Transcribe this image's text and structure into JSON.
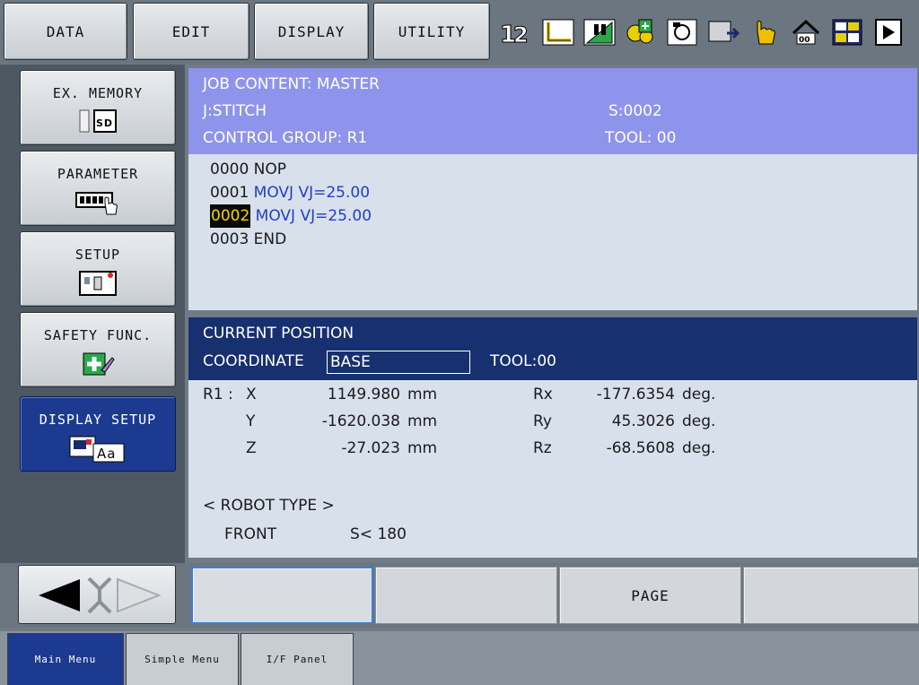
{
  "top_menu": {
    "data": "DATA",
    "edit": "EDIT",
    "display": "DISPLAY",
    "utility": "UTILITY"
  },
  "toolbar_icons": [
    "interlock-number-icon",
    "coordinate-frame-icon",
    "speed-level-icon",
    "gear-plus-icon",
    "job-file-icon",
    "monitor-arrow-icon",
    "hand-pointer-icon",
    "home-position-icon",
    "grid-panel-icon",
    "play-marker-icon"
  ],
  "sidebar": {
    "items": [
      {
        "label": "EX. MEMORY",
        "icon": "sd-card-icon"
      },
      {
        "label": "PARAMETER",
        "icon": "parameter-hand-icon"
      },
      {
        "label": "SETUP",
        "icon": "setup-panel-icon"
      },
      {
        "label": "SAFETY FUNC.",
        "icon": "safety-cross-icon"
      },
      {
        "label": "DISPLAY SETUP",
        "icon": "display-font-icon"
      }
    ]
  },
  "job": {
    "title": "JOB CONTENT: MASTER",
    "job_name": "J:STITCH",
    "step": "S:0002",
    "control_group": "CONTROL GROUP: R1",
    "tool": "TOOL: 00",
    "lines": [
      {
        "num": "0000",
        "cmd": "NOP"
      },
      {
        "num": "0001",
        "cmd": "MOVJ VJ=25.00"
      },
      {
        "num": "0002",
        "cmd": "MOVJ VJ=25.00"
      },
      {
        "num": "0003",
        "cmd": "END"
      }
    ]
  },
  "position": {
    "title": "CURRENT POSITION",
    "coordinate_label": "COORDINATE",
    "coordinate_value": "BASE",
    "tool": "TOOL:00",
    "group": "R1 :",
    "rows": [
      {
        "axis": "X",
        "value": "1149.980",
        "unit": "mm",
        "raxis": "Rx",
        "rvalue": "-177.6354",
        "runit": "deg."
      },
      {
        "axis": "Y",
        "value": "-1620.038",
        "unit": "mm",
        "raxis": "Ry",
        "rvalue": "45.3026",
        "runit": "deg."
      },
      {
        "axis": "Z",
        "value": "-27.023",
        "unit": "mm",
        "raxis": "Rz",
        "rvalue": "-68.5608",
        "runit": "deg."
      }
    ],
    "robot_type_label": "< ROBOT TYPE >",
    "robot_front": "FRONT",
    "robot_s": "S< 180"
  },
  "bottom_keys": {
    "key1": "",
    "key2": "",
    "key3": "PAGE",
    "key4": ""
  },
  "tabs": {
    "main_menu": "Main Menu",
    "simple_menu": "Simple Menu",
    "if_panel": "I/F Panel"
  },
  "colors": {
    "job_header": "#8e94ec",
    "position_header": "#17306f",
    "command_text": "#1f3ec7",
    "cursor_text": "#f5d400"
  }
}
